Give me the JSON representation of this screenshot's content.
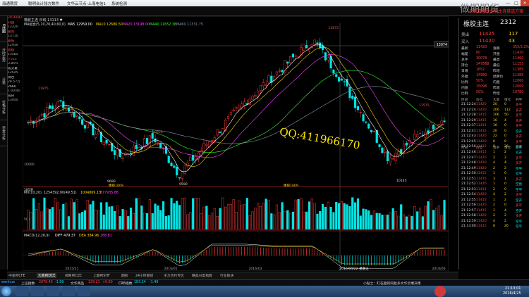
{
  "titlebar": {
    "app": "海通期货",
    "menus": [
      "聪明会计钱方数件",
      "文华云节点-上海电信1",
      "系统检测"
    ],
    "win": [
      "—",
      "□",
      "✕"
    ]
  },
  "left_tabs": [
    "K线图",
    "分时走势",
    "分笔",
    "价格分析",
    "资金分析"
  ],
  "info": {
    "lines": [
      "20160425",
      "开盘",
      "13320",
      "最高",
      "13710",
      "最低",
      "12930",
      "收盘",
      "13485",
      "+515",
      "3.85%",
      "成交量",
      "12645",
      "持仓",
      "28.57万",
      "2660",
      "1.00/40",
      "前日",
      "13040"
    ]
  },
  "chart_header": {
    "contract": "橡胶主连 日线 13113 ▼",
    "ma_line": "MA组合(5,10,20,40,60,0)",
    "ma5": "MA5 12959.00",
    "ma10": "MA10 12686.50",
    "ma20": "MA20 13198.00",
    "ma40": "MA40 11652.38",
    "ma60": "MA60 11331.75"
  },
  "price_labels": {
    "cursor_price": "13074",
    "high_mark": "13875",
    "left_high": "11875",
    "peak_left": "10935",
    "low_mark1": "9680",
    "low_mark2": "9590",
    "low_mark3": "10145",
    "right_mark": "11575",
    "floor_price": "10000",
    "bottom_tag": "185天",
    "mid_tag": "橡胶1609",
    "mid_tag2": "橡胶1609"
  },
  "vol_header": {
    "name": "MV(10,20)",
    "v1": "1254392.00(49:51)",
    "v2": "1004869.13",
    "v3": "877935.88",
    "scale": "500"
  },
  "macd_header": {
    "name": "MACD(12,26,9)",
    "dif": "DIFF 479.37",
    "dea": "DEA 384.96",
    "macd": "188.81"
  },
  "x_axis": [
    "2015/11",
    "2016/01",
    "2016/03",
    "2016/04/22 星期五",
    "2016/06"
  ],
  "chart_data": {
    "type": "candlestick",
    "title": "橡胶主连 日线",
    "series_count": "visible candles approx 155"
  },
  "watermark": "QQ:411966170",
  "red_banner": "◎期货超级全能主连首选方案",
  "big_title": "做期期货",
  "right": {
    "title": "橡胶主连",
    "code": "2312",
    "sell": {
      "label": "卖出",
      "price": "11425",
      "vol": "117"
    },
    "buy": {
      "label": "买入",
      "price": "11420",
      "vol": "43"
    },
    "stats": [
      [
        "最新",
        "11420",
        "涨跌",
        "355/3.2%"
      ],
      [
        "幅差",
        "80",
        "开盘",
        "11410"
      ],
      [
        "总手",
        "30078",
        "最高",
        "11460"
      ],
      [
        "持仓",
        "347868",
        "最低",
        "11155"
      ],
      [
        "日增",
        "1652",
        "昨结",
        "11385"
      ],
      [
        "外盘",
        "14980",
        "结算价",
        "11385"
      ],
      [
        "比例",
        "50%",
        "内盘",
        "12060"
      ],
      [
        "内盘",
        "15098",
        "昨收",
        "12069"
      ],
      [
        "比例",
        "50%",
        "昨结",
        "10780"
      ]
    ],
    "tick_head": [
      "时间",
      "价位",
      "大单",
      "增仓",
      "开平"
    ],
    "ticks1": [
      [
        "21:12:24",
        "11420",
        "20",
        "0",
        "多平"
      ],
      [
        "21:12:24",
        "11420",
        "206",
        "112",
        "多开"
      ],
      [
        "21:12:28",
        "11415",
        "106",
        "50",
        "多平"
      ],
      [
        "21:12:29",
        "11415",
        "16",
        "4",
        "多开"
      ],
      [
        "21:12:37",
        "11415",
        "16",
        "0",
        "多平"
      ],
      [
        "21:12:41",
        "11415",
        "20",
        "0",
        "空开"
      ],
      [
        "21:12:43",
        "11420",
        "22",
        "0",
        "多开"
      ],
      [
        "21:12:45",
        "11420",
        "8",
        "8",
        "多平"
      ],
      [
        "21:12:50",
        "11415",
        "8",
        "26",
        "空开"
      ]
    ],
    "tick_head2": [
      "时间",
      "价位",
      "现手",
      "增仓",
      "开平"
    ],
    "ticks2": [
      [
        "21:12:46",
        "11415",
        "1",
        "2",
        "双开"
      ],
      [
        "21:12:47",
        "11420",
        "2",
        "2",
        "多平"
      ],
      [
        "21:12:48",
        "11420",
        "4",
        "4",
        "多开"
      ],
      [
        "21:12:49",
        "11420",
        "2",
        "2",
        "空平"
      ],
      [
        "21:12:50",
        "11415",
        "1",
        "0",
        "双平"
      ],
      [
        "21:12:51",
        "11415",
        "3",
        "1",
        "多开"
      ],
      [
        "21:12:52",
        "11420",
        "1",
        "0",
        "空换"
      ],
      [
        "21:12:53",
        "11415",
        "2",
        "0",
        "空平"
      ],
      [
        "21:12:54",
        "11420",
        "4",
        "2",
        "多平"
      ],
      [
        "21:12:55",
        "11415",
        "1",
        "2",
        "空开"
      ],
      [
        "21:12:56",
        "11420",
        "2",
        "0",
        "多平"
      ],
      [
        "21:12:57",
        "11415",
        "1",
        "4",
        "空开"
      ],
      [
        "21:12:58",
        "11420",
        "2",
        "2",
        "多开"
      ],
      [
        "21:12:59",
        "11420",
        "4",
        "2",
        "空平"
      ],
      [
        "21:13:00",
        "11415",
        "8",
        "26",
        "空平"
      ]
    ]
  },
  "bottom_tabs": [
    "中金所CFE",
    "大商所DCE",
    "郑商所CZC",
    "上期所SHF",
    "期权",
    "24小时期货",
    "主力合约专区",
    "精品分类指数",
    "行业板块"
  ],
  "status": {
    "s1": "上证指数",
    "s1v": "2979.43",
    "s1c": "-1.99",
    "s2": "文华商品",
    "s2v": "129.21",
    "s2c": "+0.60",
    "s3": "CRB指数",
    "s3v": "183.14",
    "s3c": "-1.49",
    "news": "小贴士：盯在盘的同复多文华云端决策",
    "clock": "21:13:01",
    "date": "2016/4/25"
  },
  "colors": {
    "up": "#ff3b3b",
    "down": "#00e5e5",
    "ma5": "#ffffff",
    "ma10": "#ffd700",
    "ma20": "#ff44ff",
    "ma40": "#33ff33",
    "ma60": "#8899aa"
  }
}
